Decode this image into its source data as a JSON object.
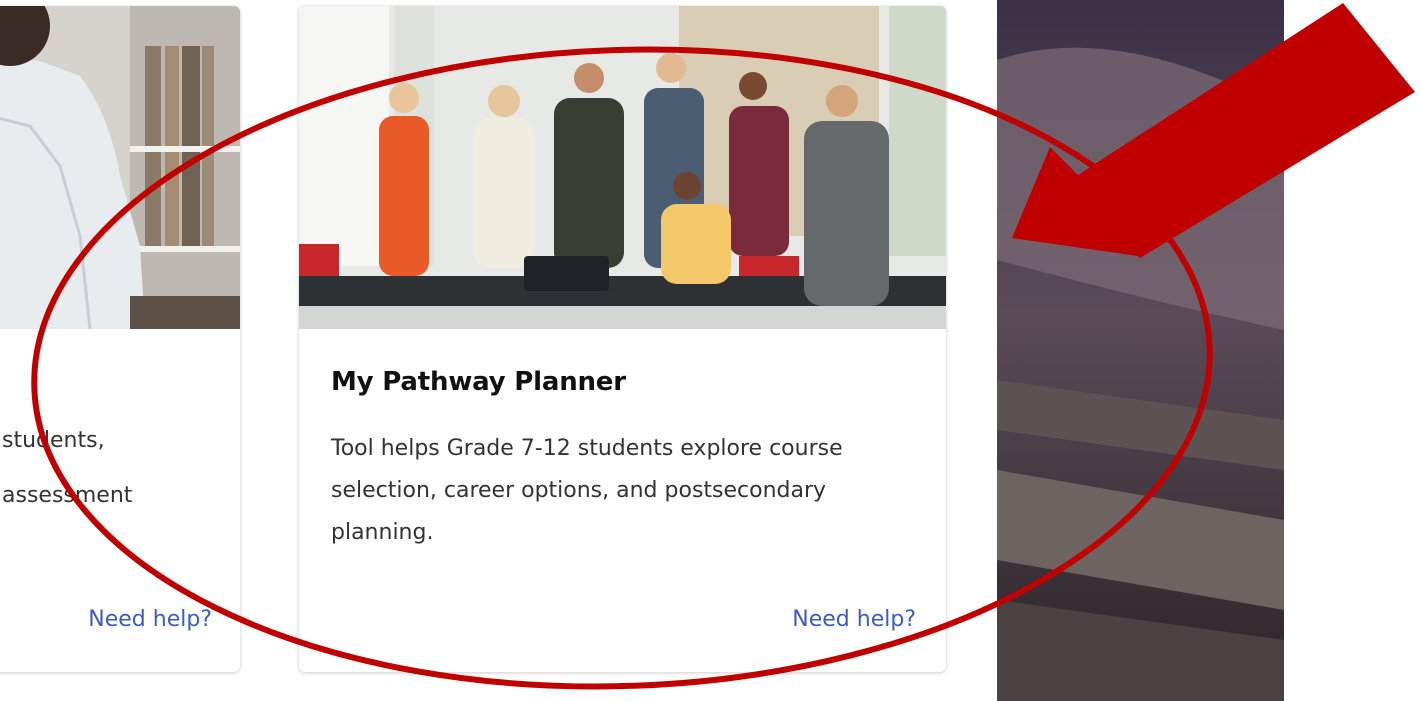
{
  "cards": [
    {
      "title": "",
      "description_lines": [
        "students,",
        "assessment"
      ],
      "help_link": "Need help?"
    },
    {
      "title": "My Pathway Planner",
      "description": "Tool helps Grade 7-12 students explore course selection, career options, and postsecondary planning.",
      "help_link": "Need help?"
    }
  ],
  "annotation": {
    "color": "#c00000",
    "shapes": [
      "ellipse",
      "arrow"
    ]
  }
}
